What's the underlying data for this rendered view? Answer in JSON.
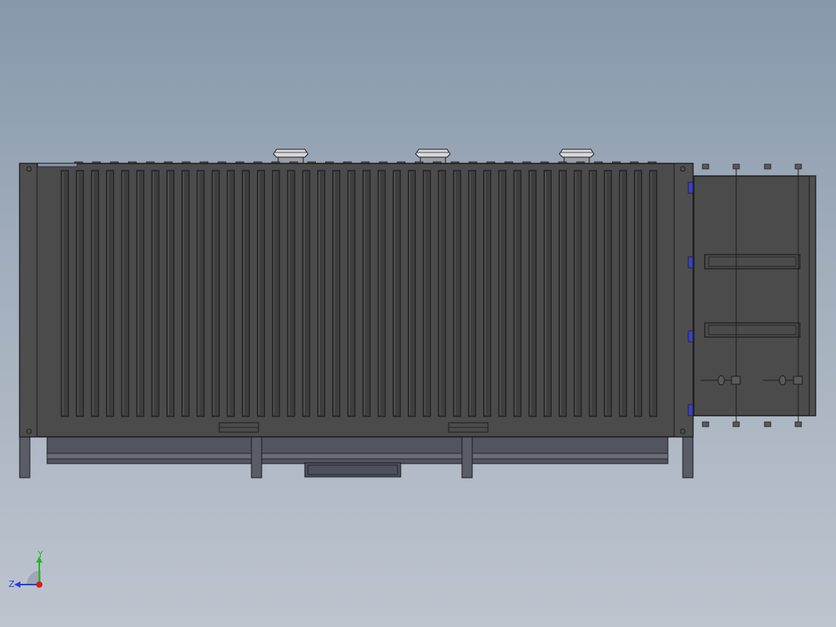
{
  "viewport": {
    "background_top": "#8798ab",
    "background_bottom": "#bdc4ce"
  },
  "model": {
    "body_color": "#4b4b4b",
    "edge_color": "#1c1c1c",
    "detail_color": "#6a6a6a",
    "fin_count": 40,
    "top_bolt_count": 33
  },
  "triad": {
    "y_label": "Y",
    "z_label": "Z",
    "y_color": "#27b227",
    "z_color": "#2a3de0",
    "origin_color": "#d81b1b"
  }
}
